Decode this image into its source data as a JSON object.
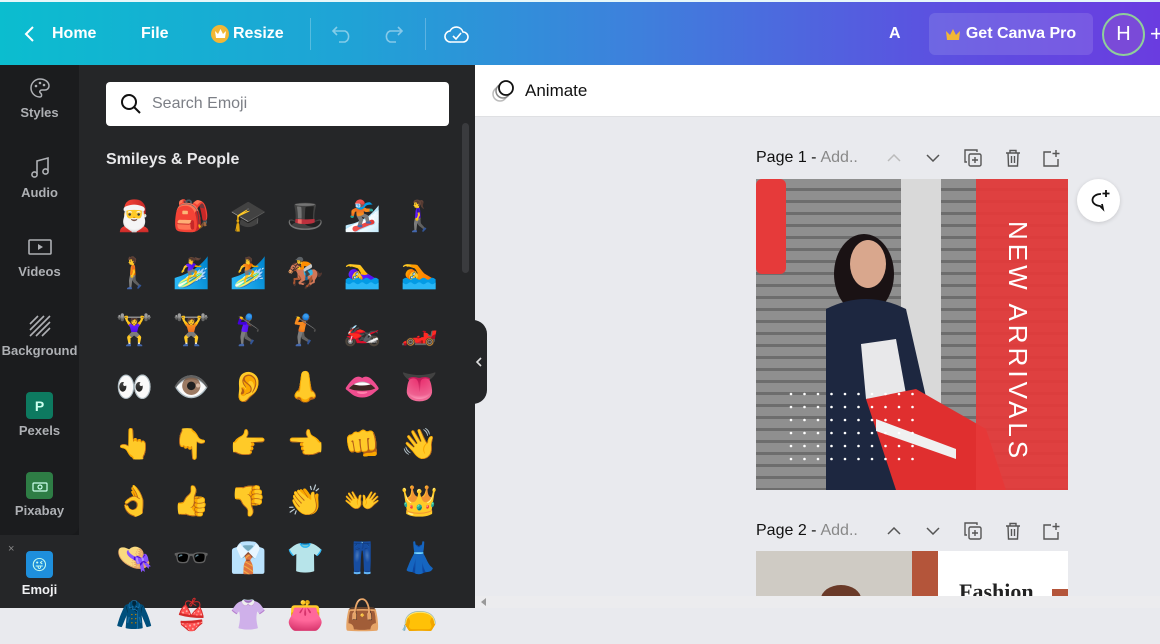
{
  "topbar": {
    "home_label": "Home",
    "file_label": "File",
    "resize_label": "Resize",
    "account_initial": "A",
    "pro_label": "Get Canva Pro",
    "avatar_initial": "H"
  },
  "rail": {
    "items": [
      {
        "label": "Styles",
        "icon": "palette-icon"
      },
      {
        "label": "Audio",
        "icon": "music-note-icon"
      },
      {
        "label": "Videos",
        "icon": "video-icon"
      },
      {
        "label": "Background",
        "icon": "background-pattern-icon"
      },
      {
        "label": "Pexels",
        "icon": "pexels-icon"
      },
      {
        "label": "Pixabay",
        "icon": "pixabay-icon"
      },
      {
        "label": "Emoji",
        "icon": "emoji-icon"
      }
    ],
    "close_glyph": "×"
  },
  "panel": {
    "search_placeholder": "Search Emoji",
    "section_title": "Smileys & People",
    "emojis": [
      "🎅",
      "🎒",
      "🎓",
      "🎩",
      "🏂",
      "🚶‍♀️",
      "🚶",
      "🏄‍♀️",
      "🏄",
      "🏇",
      "🏊‍♀️",
      "🏊",
      "🏋️‍♀️",
      "🏋️",
      "🏌️‍♀️",
      "🏌️",
      "🏍️",
      "🏎️",
      "👀",
      "👁️",
      "👂",
      "👃",
      "👄",
      "👅",
      "👆",
      "👇",
      "👉",
      "👈",
      "👊",
      "👋",
      "👌",
      "👍",
      "👎",
      "👏",
      "👐",
      "👑",
      "👒",
      "🕶️",
      "👔",
      "👕",
      "👖",
      "👗",
      "🧥",
      "👙",
      "👚",
      "👛",
      "👜",
      "👝"
    ]
  },
  "canvas": {
    "animate_label": "Animate",
    "pages": [
      {
        "title": "Page 1 -",
        "add_placeholder": "Add..",
        "design_text": "NEW ARRIVALS"
      },
      {
        "title": "Page 2 -",
        "add_placeholder": "Add..",
        "design_text": "Fashion"
      }
    ]
  },
  "colors": {
    "design_red": "#e63a3a",
    "design_rust": "#b4553a",
    "panel_bg": "#252628"
  }
}
